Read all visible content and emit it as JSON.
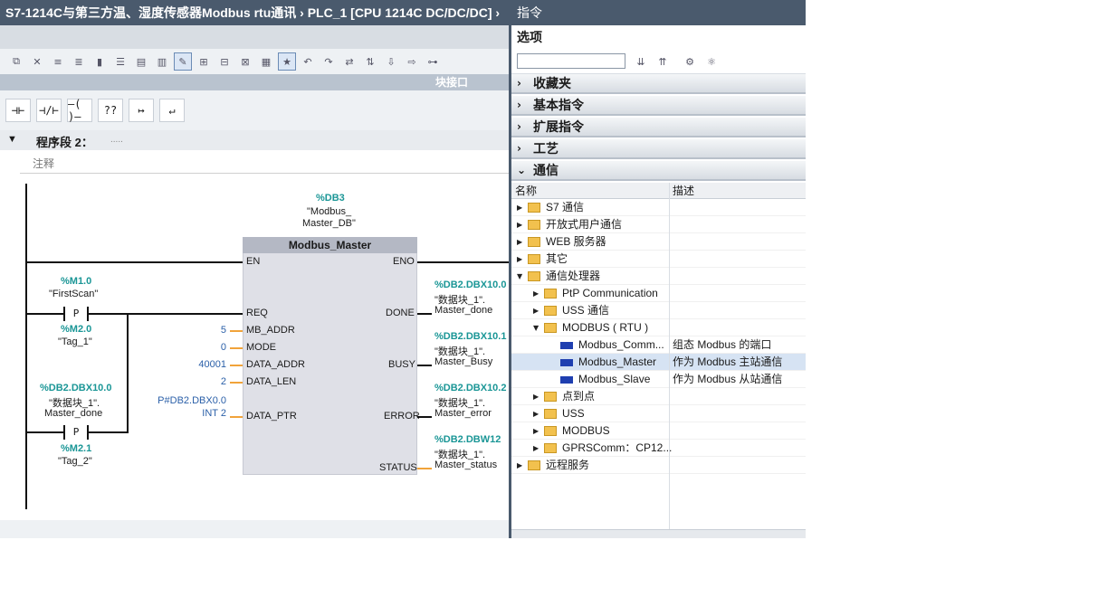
{
  "title_bar": {
    "path": "S7-1214C与第三方温、湿度传感器Modbus rtu通讯  ›  PLC_1 [CPU 1214C DC/DC/DC]  ›"
  },
  "instructions": {
    "title": "指令",
    "options_label": "选项"
  },
  "block_interface_label": "块接口",
  "network": {
    "title": "程序段 2：",
    "dots": ".....",
    "comment": "注释"
  },
  "ladder_buttons": [
    "⊣⊢",
    "⊣/⊢",
    "–( )–",
    "??",
    "↦",
    "↵"
  ],
  "db": {
    "addr": "%DB3",
    "name1": "\"Modbus_",
    "name2": "Master_DB\""
  },
  "fb": {
    "name": "Modbus_Master"
  },
  "contacts": [
    {
      "addr": "%M1.0",
      "tag": "\"FirstScan\"",
      "type": "P",
      "addr2": "%M2.0",
      "tag2": "\"Tag_1\""
    },
    {
      "addr": "%DB2.DBX10.0",
      "tag": "\"数据块_1\".",
      "tag_b": "Master_done",
      "type": "P",
      "addr2": "%M2.1",
      "tag2": "\"Tag_2\""
    }
  ],
  "inputs": [
    {
      "pin": "EN",
      "value": ""
    },
    {
      "pin": "REQ",
      "value": ""
    },
    {
      "pin": "MB_ADDR",
      "value": "5"
    },
    {
      "pin": "MODE",
      "value": "0"
    },
    {
      "pin": "DATA_ADDR",
      "value": "40001"
    },
    {
      "pin": "DATA_LEN",
      "value": "2"
    },
    {
      "pin": "DATA_PTR",
      "value": "P#DB2.DBX0.0",
      "value2": "INT 2"
    }
  ],
  "outputs": [
    {
      "pin": "ENO",
      "addr": "",
      "tag1": "",
      "tag2": ""
    },
    {
      "pin": "DONE",
      "addr": "%DB2.DBX10.0",
      "tag1": "\"数据块_1\".",
      "tag2": "Master_done"
    },
    {
      "pin": "BUSY",
      "addr": "%DB2.DBX10.1",
      "tag1": "\"数据块_1\".",
      "tag2": "Master_Busy"
    },
    {
      "pin": "ERROR",
      "addr": "%DB2.DBX10.2",
      "tag1": "\"数据块_1\".",
      "tag2": "Master_error"
    },
    {
      "pin": "STATUS",
      "addr": "%DB2.DBW12",
      "tag1": "\"数据块_1\".",
      "tag2": "Master_status"
    }
  ],
  "sections": [
    {
      "label": "收藏夹",
      "expanded": false
    },
    {
      "label": "基本指令",
      "expanded": false
    },
    {
      "label": "扩展指令",
      "expanded": false
    },
    {
      "label": "工艺",
      "expanded": false
    },
    {
      "label": "通信",
      "expanded": true
    }
  ],
  "table": {
    "col_name": "名称",
    "col_desc": "描述",
    "rows": [
      {
        "label": "S7 通信",
        "level": 0,
        "icon": "folder",
        "toggle": "collapsed",
        "desc": ""
      },
      {
        "label": "开放式用户通信",
        "level": 0,
        "icon": "folder",
        "toggle": "collapsed",
        "desc": ""
      },
      {
        "label": "WEB 服务器",
        "level": 0,
        "icon": "folder",
        "toggle": "collapsed",
        "desc": ""
      },
      {
        "label": "其它",
        "level": 0,
        "icon": "folder",
        "toggle": "collapsed",
        "desc": ""
      },
      {
        "label": "通信处理器",
        "level": 0,
        "icon": "folder",
        "toggle": "expanded",
        "desc": ""
      },
      {
        "label": "PtP Communication",
        "level": 1,
        "icon": "folder",
        "toggle": "collapsed",
        "desc": ""
      },
      {
        "label": "USS 通信",
        "level": 1,
        "icon": "folder",
        "toggle": "collapsed",
        "desc": ""
      },
      {
        "label": "MODBUS ( RTU )",
        "level": 1,
        "icon": "folder",
        "toggle": "expanded",
        "desc": ""
      },
      {
        "label": "Modbus_Comm...",
        "level": 2,
        "icon": "block",
        "toggle": "none",
        "desc": "组态 Modbus 的端口"
      },
      {
        "label": "Modbus_Master",
        "level": 2,
        "icon": "block",
        "toggle": "none",
        "desc": "作为 Modbus 主站通信",
        "selected": true
      },
      {
        "label": "Modbus_Slave",
        "level": 2,
        "icon": "block",
        "toggle": "none",
        "desc": "作为 Modbus 从站通信"
      },
      {
        "label": "点到点",
        "level": 1,
        "icon": "folder",
        "toggle": "collapsed",
        "desc": ""
      },
      {
        "label": "USS",
        "level": 1,
        "icon": "folder",
        "toggle": "collapsed",
        "desc": ""
      },
      {
        "label": "MODBUS",
        "level": 1,
        "icon": "folder",
        "toggle": "collapsed",
        "desc": ""
      },
      {
        "label": "GPRSComm：CP12...",
        "level": 1,
        "icon": "folder",
        "toggle": "collapsed",
        "desc": ""
      },
      {
        "label": "远程服务",
        "level": 0,
        "icon": "folder",
        "toggle": "collapsed",
        "desc": ""
      }
    ]
  },
  "colors": {
    "title_bg": "#4a5a6d",
    "addr": "#1a9696",
    "pin_line": "#f1a33a",
    "value": "#2a5fa8",
    "selected_row": "#d6e3f3"
  }
}
